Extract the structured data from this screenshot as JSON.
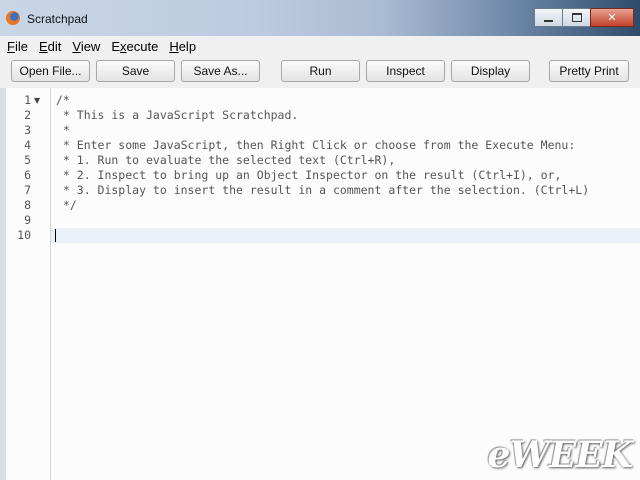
{
  "window": {
    "title": "Scratchpad",
    "icon": "firefox-icon",
    "controls": [
      "minimize",
      "maximize",
      "close"
    ]
  },
  "menu": [
    {
      "label": "File",
      "mnemonic": "F"
    },
    {
      "label": "Edit",
      "mnemonic": "E"
    },
    {
      "label": "View",
      "mnemonic": "V"
    },
    {
      "label": "Execute",
      "mnemonic": "x"
    },
    {
      "label": "Help",
      "mnemonic": "H"
    }
  ],
  "toolbar": {
    "open_file": "Open File...",
    "save": "Save",
    "save_as": "Save As...",
    "run": "Run",
    "inspect": "Inspect",
    "display": "Display",
    "pretty_print": "Pretty Print"
  },
  "editor": {
    "lines": [
      "/*",
      " * This is a JavaScript Scratchpad.",
      " *",
      " * Enter some JavaScript, then Right Click or choose from the Execute Menu:",
      " * 1. Run to evaluate the selected text (Ctrl+R),",
      " * 2. Inspect to bring up an Object Inspector on the result (Ctrl+I), or,",
      " * 3. Display to insert the result in a comment after the selection. (Ctrl+L)",
      " */",
      "",
      ""
    ],
    "line_numbers": [
      "1",
      "2",
      "3",
      "4",
      "5",
      "6",
      "7",
      "8",
      "9",
      "10"
    ],
    "current_line": 10
  },
  "watermark": "eWEEK"
}
